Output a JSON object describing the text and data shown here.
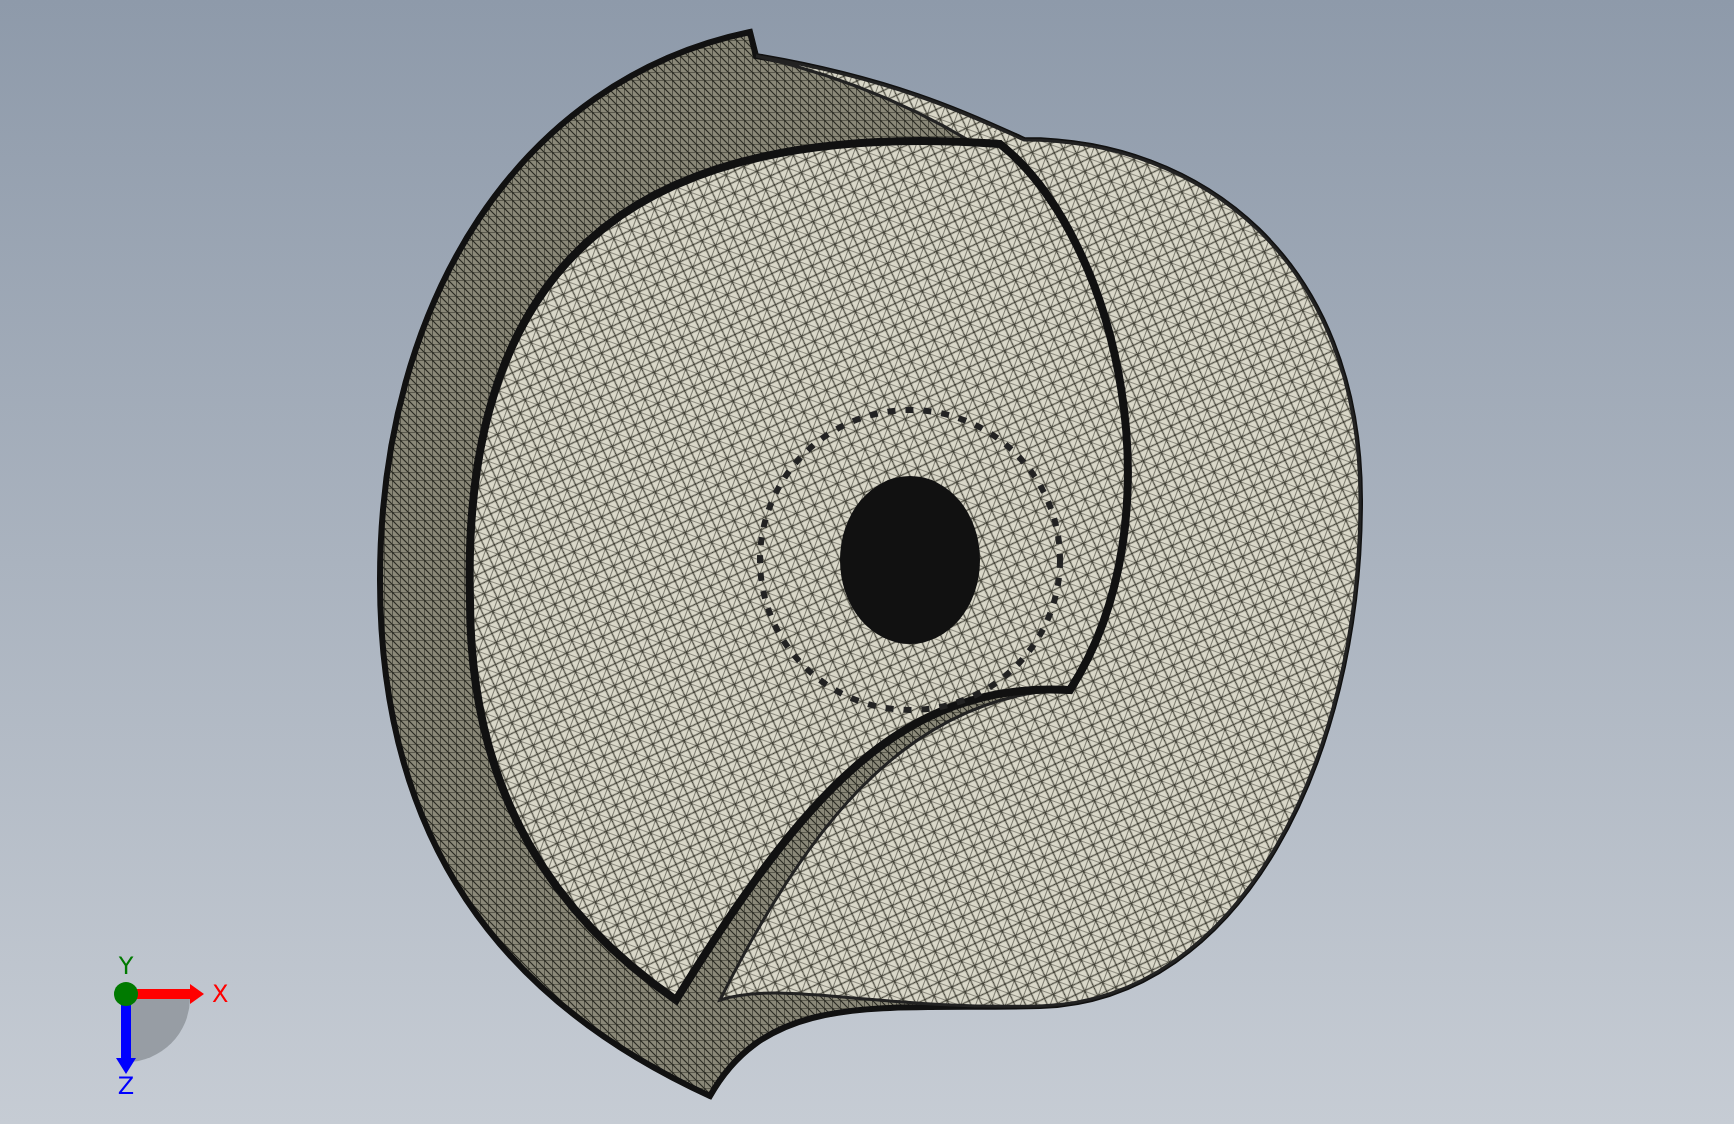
{
  "triad": {
    "axes": [
      {
        "kind": "x",
        "label": "X",
        "color": "#ff0000"
      },
      {
        "kind": "y",
        "label": "Y",
        "color": "#007a00"
      },
      {
        "kind": "z",
        "label": "Z",
        "color": "#0000ff"
      }
    ]
  }
}
